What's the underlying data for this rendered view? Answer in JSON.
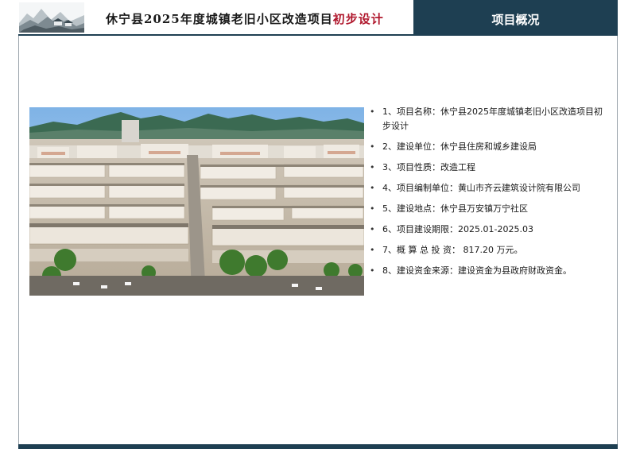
{
  "header": {
    "title_main": "休宁县2025年度城镇老旧小区改造项目",
    "title_accent": "初步设计",
    "section": "项目概况"
  },
  "photo": {
    "name": "aerial-town-photo"
  },
  "items": [
    "1、项目名称：休宁县2025年度城镇老旧小区改造项目初步设计",
    "2、建设单位：休宁县住房和城乡建设局",
    "3、项目性质：改造工程",
    "4、项目编制单位：黄山市齐云建筑设计院有限公司",
    "5、建设地点：休宁县万安镇万宁社区",
    "6、项目建设期限：2025.01-2025.03",
    "7、概 算 总 投 资： 817.20 万元。",
    "8、建设资金来源：建设资金为县政府财政资金。"
  ],
  "colors": {
    "header_bg": "#1e3f52",
    "accent": "#b0182d"
  }
}
